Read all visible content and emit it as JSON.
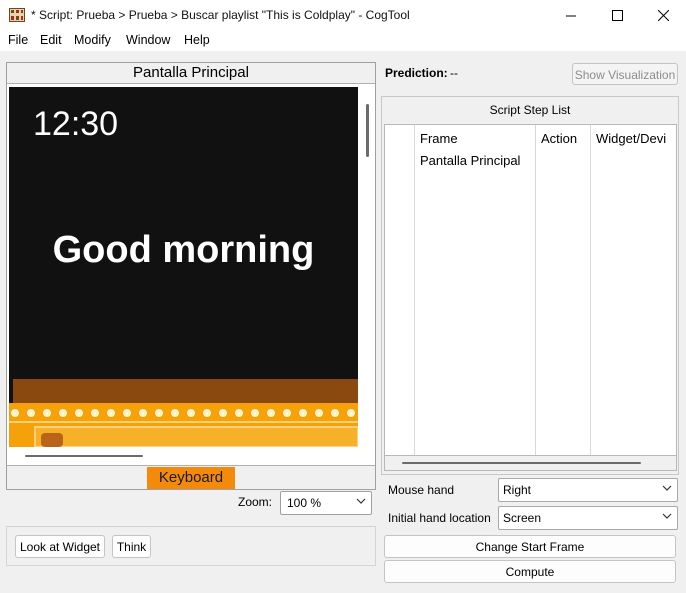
{
  "window": {
    "title": "* Script: Prueba > Prueba > Buscar playlist \"This is Coldplay\" - CogTool",
    "controls": [
      "minimize",
      "maximize",
      "close"
    ]
  },
  "menu": [
    "File",
    "Edit",
    "Modify",
    "Window",
    "Help"
  ],
  "frame": {
    "title": "Pantalla Principal",
    "clock": "12:30",
    "greeting": "Good morning",
    "keyboard_label": "Keyboard"
  },
  "zoom": {
    "label": "Zoom:",
    "value": "100 %"
  },
  "left_buttons": {
    "look": "Look at Widget",
    "think": "Think"
  },
  "prediction": {
    "label": "Prediction:",
    "value": "--",
    "show_visualization": "Show Visualization"
  },
  "script_steps": {
    "title": "Script Step List",
    "columns": [
      "Frame",
      "Action",
      "Widget/Devi"
    ],
    "rows": [
      {
        "frame": "Pantalla Principal",
        "action": "",
        "widget": ""
      }
    ]
  },
  "settings": {
    "mouse_hand_label": "Mouse hand",
    "mouse_hand_value": "Right",
    "hand_location_label": "Initial hand location",
    "hand_location_value": "Screen"
  },
  "actions": {
    "change_start_frame": "Change Start Frame",
    "compute": "Compute"
  },
  "colors": {
    "keyboard_widget": "#f48a0c",
    "frame_background": "#111111",
    "pattern_orange": "#f5a20a"
  },
  "icons": [
    "cogtool-app-icon",
    "minimize-icon",
    "maximize-icon",
    "close-icon",
    "chevron-down-icon"
  ]
}
